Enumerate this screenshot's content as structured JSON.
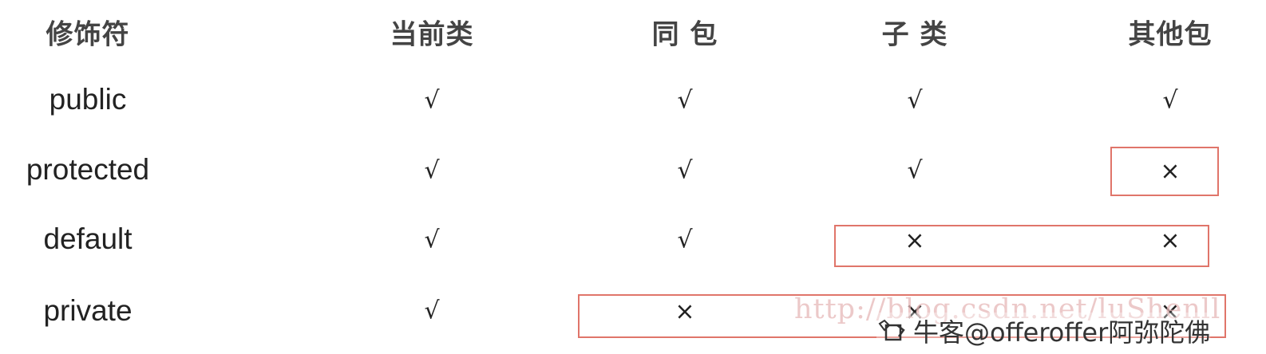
{
  "table": {
    "headers": [
      "修饰符",
      "当前类",
      "同 包",
      "子 类",
      "其他包"
    ],
    "rows": [
      {
        "modifier": "public",
        "marks": [
          "√",
          "√",
          "√",
          "√"
        ]
      },
      {
        "modifier": "protected",
        "marks": [
          "√",
          "√",
          "√",
          "×"
        ]
      },
      {
        "modifier": "default",
        "marks": [
          "√",
          "√",
          "×",
          "×"
        ]
      },
      {
        "modifier": "private",
        "marks": [
          "√",
          "×",
          "×",
          "×"
        ]
      }
    ]
  },
  "highlight_color": "#e0756a",
  "watermark": {
    "url": "http://blog.csdn.net/luShenll",
    "brand": "牛客@offeroffer阿弥陀佛",
    "logo_icon": "nowcoder-logo-icon"
  }
}
